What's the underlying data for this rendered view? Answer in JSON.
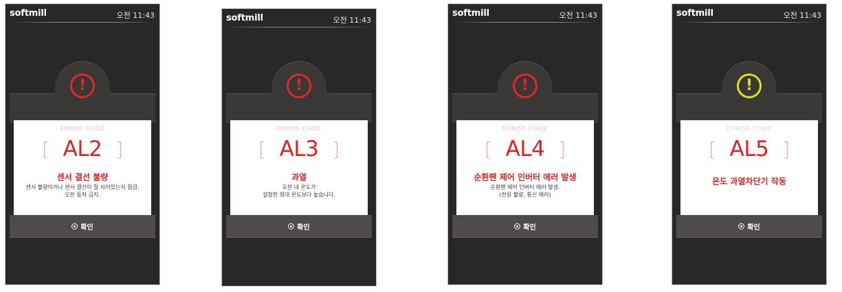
{
  "screens": [
    {
      "brand": "softmill",
      "clock": "오전 11:43",
      "icon": "alert-icon",
      "icon_color": "#e02828",
      "icon_glyph": "!",
      "error_caption": "ERROR CODE",
      "bracket_open": "[",
      "code": "AL2",
      "bracket_close": "]",
      "title": "센서 결선 불량",
      "desc_line1": "센서 불량이거나 센서 결선이 잘 되어있는지 점검.",
      "desc_line2": "오븐 동작 금지.",
      "confirm_label": "확인"
    },
    {
      "brand": "softmill",
      "clock": "오전 11:43",
      "icon": "alert-icon",
      "icon_color": "#e02828",
      "icon_glyph": "!",
      "error_caption": "ERROR CODE",
      "bracket_open": "[",
      "code": "AL3",
      "bracket_close": "]",
      "title": "과열",
      "desc_line1": "오븐 내 온도가",
      "desc_line2": "설정한 최대 온도보다 높습니다.",
      "confirm_label": "확인"
    },
    {
      "brand": "softmill",
      "clock": "오전 11:43",
      "icon": "alert-icon",
      "icon_color": "#e02828",
      "icon_glyph": "!",
      "error_caption": "ERROR CODE",
      "bracket_open": "[",
      "code": "AL4",
      "bracket_close": "]",
      "title": "순환팬 제어 인버터 에러 발생",
      "desc_line1": "순환팬 제어 인버터 에러 발생.",
      "desc_line2": "(전원 불량, 통신 에러)",
      "confirm_label": "확인"
    },
    {
      "brand": "softmill",
      "clock": "오전 11:43",
      "icon": "alert-icon",
      "icon_color": "#e0e020",
      "icon_glyph": "!",
      "error_caption": "ERROR CODE",
      "bracket_open": "[",
      "code": "AL5",
      "bracket_close": "]",
      "title": "온도 과열차단기 작동",
      "confirm_label": "확인"
    }
  ]
}
